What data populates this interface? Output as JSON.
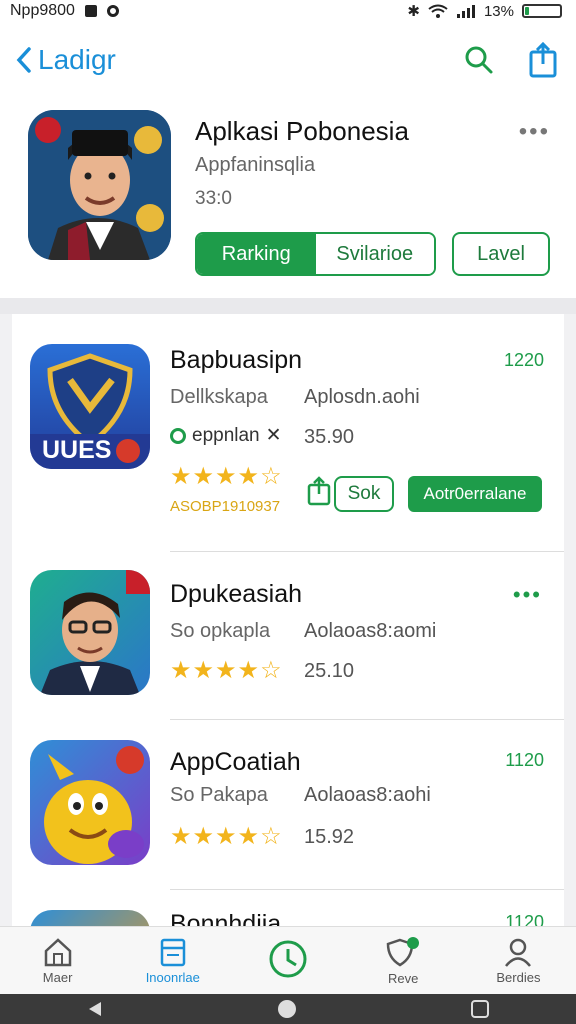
{
  "status_bar": {
    "left_text": "Npp9800",
    "battery_text": "13%",
    "battery_level": 0.13,
    "icons": [
      "square-icon",
      "dot-icon",
      "bluetooth-icon",
      "wifi-icon",
      "signal-icon"
    ]
  },
  "header": {
    "back_label": "Ladigr",
    "icons": [
      "chevron-left-icon",
      "search-icon",
      "share-icon"
    ]
  },
  "featured": {
    "title": "Aplkasi Pobonesia",
    "subtitle": "Appfaninsqlia",
    "size": "33:0",
    "segments": [
      {
        "label": "Rarking",
        "active": true
      },
      {
        "label": "Svilarioe",
        "active": false
      }
    ],
    "level_button": "Lavel",
    "more_label": "•••"
  },
  "apps": [
    {
      "name": "Bapbuasipn",
      "developer": "Dellkskapa",
      "developer2": "Aplosdn.aohi",
      "price": "1220",
      "tag": "eppnlan",
      "tag_mark": "✕",
      "tag_value": "35.90",
      "stars": "★★★★☆",
      "rating_value": 4.5,
      "code": "ASOBP1910937",
      "sok_label": "Sok",
      "install_label": "Aotr0erralane",
      "icon_text": "UUES",
      "icon": "shield-icon"
    },
    {
      "name": "Dpukeasiah",
      "developer": "So opkapla",
      "developer2": "Aolaoas8:aomi",
      "menu": "•••",
      "stars": "★★★★☆",
      "rating_value": 4.5,
      "rating": "25.10",
      "icon": "avatar-icon"
    },
    {
      "name": "AppCoatiah",
      "developer": "So Pakapa",
      "developer2": "Aolaoas8:aohi",
      "price": "1120",
      "stars": "★★★★☆",
      "rating_value": 4.5,
      "rating": "15.92",
      "icon": "cartoon-icon"
    },
    {
      "name": "Bonnhdiia",
      "price": "1120"
    }
  ],
  "tabbar": [
    {
      "label": "Maer",
      "icon": "home-icon",
      "active": false
    },
    {
      "label": "Inoonrlae",
      "icon": "list-icon",
      "active": true
    },
    {
      "label": "",
      "icon": "clock-icon",
      "active": false
    },
    {
      "label": "Reve",
      "icon": "shield-badge-icon",
      "active": false
    },
    {
      "label": "Berdies",
      "icon": "person-icon",
      "active": false
    }
  ],
  "colors": {
    "accent_green": "#1e9c4a",
    "accent_blue": "#1a8fd8",
    "star_yellow": "#f2b41c"
  }
}
